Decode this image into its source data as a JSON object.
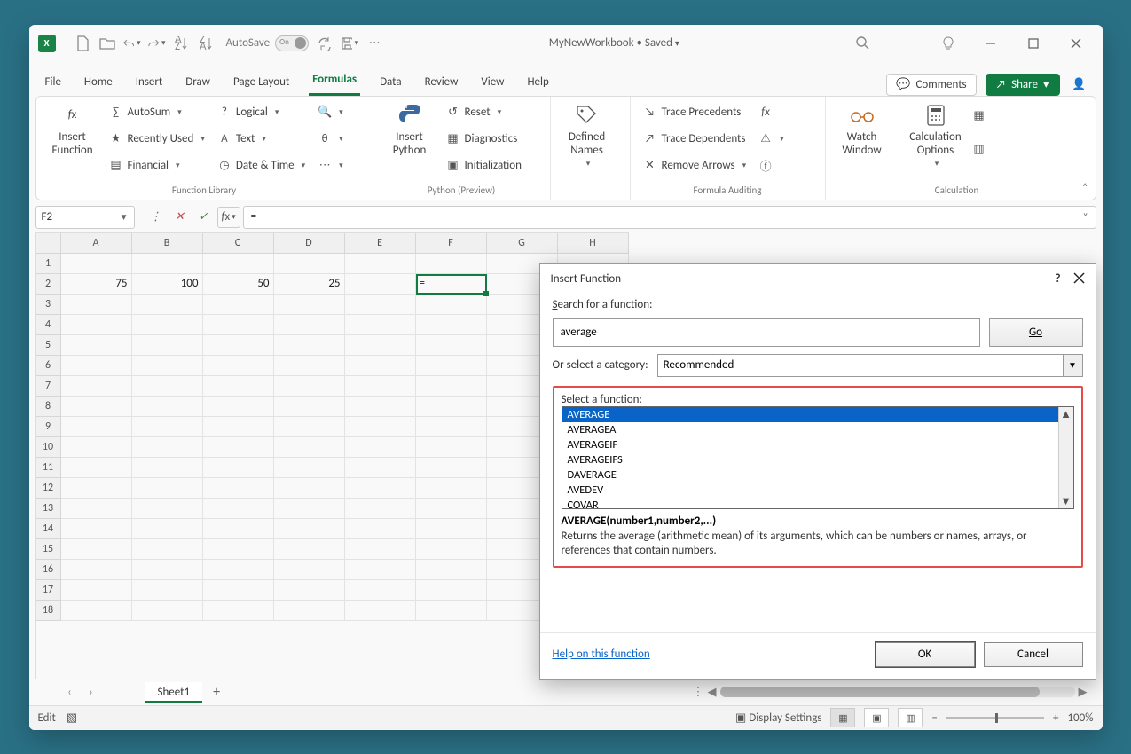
{
  "titlebar": {
    "autosave_label": "AutoSave",
    "autosave_state": "On",
    "doc_title": "MyNewWorkbook • Saved"
  },
  "tabs": {
    "items": [
      "File",
      "Home",
      "Insert",
      "Draw",
      "Page Layout",
      "Formulas",
      "Data",
      "Review",
      "View",
      "Help"
    ],
    "active": "Formulas",
    "comments": "Comments",
    "share": "Share"
  },
  "ribbon": {
    "insert_function": "Insert\nFunction",
    "function_library_group": "Function Library",
    "lib": {
      "autosum": "AutoSum",
      "recently": "Recently Used",
      "financial": "Financial",
      "logical": "Logical",
      "text": "Text",
      "datetime": "Date & Time"
    },
    "python": {
      "insert_python": "Insert\nPython",
      "reset": "Reset",
      "diagnostics": "Diagnostics",
      "initialization": "Initialization",
      "group": "Python (Preview)"
    },
    "defined_names": "Defined\nNames",
    "auditing": {
      "trace_prec": "Trace Precedents",
      "trace_dep": "Trace Dependents",
      "remove_arrows": "Remove Arrows",
      "group": "Formula Auditing"
    },
    "watch_window": "Watch\nWindow",
    "calc_options": "Calculation\nOptions",
    "calc_group": "Calculation"
  },
  "formula_bar": {
    "cell_ref": "F2",
    "formula": "="
  },
  "grid": {
    "columns": [
      "A",
      "B",
      "C",
      "D",
      "E",
      "F",
      "G",
      "H"
    ],
    "rows": 18,
    "active_cell": {
      "col": "F",
      "row": 2,
      "display": "="
    },
    "data": {
      "2": {
        "A": "75",
        "B": "100",
        "C": "50",
        "D": "25"
      }
    }
  },
  "sheets": {
    "active": "Sheet1"
  },
  "statusbar": {
    "mode": "Edit",
    "display": "Display Settings",
    "zoom": "100%"
  },
  "dialog": {
    "title": "Insert Function",
    "search_label": "Search for a function:",
    "search_value": "average",
    "go": "Go",
    "cat_label": "Or select a category:",
    "cat_value": "Recommended",
    "select_fn_label": "Select a function:",
    "functions": [
      "AVERAGE",
      "AVERAGEA",
      "AVERAGEIF",
      "AVERAGEIFS",
      "DAVERAGE",
      "AVEDEV",
      "COVAR"
    ],
    "selected_index": 0,
    "signature": "AVERAGE(number1,number2,...)",
    "description": "Returns the average (arithmetic mean) of its arguments, which can be numbers or names, arrays, or references that contain numbers.",
    "help": "Help on this function",
    "ok": "OK",
    "cancel": "Cancel"
  }
}
